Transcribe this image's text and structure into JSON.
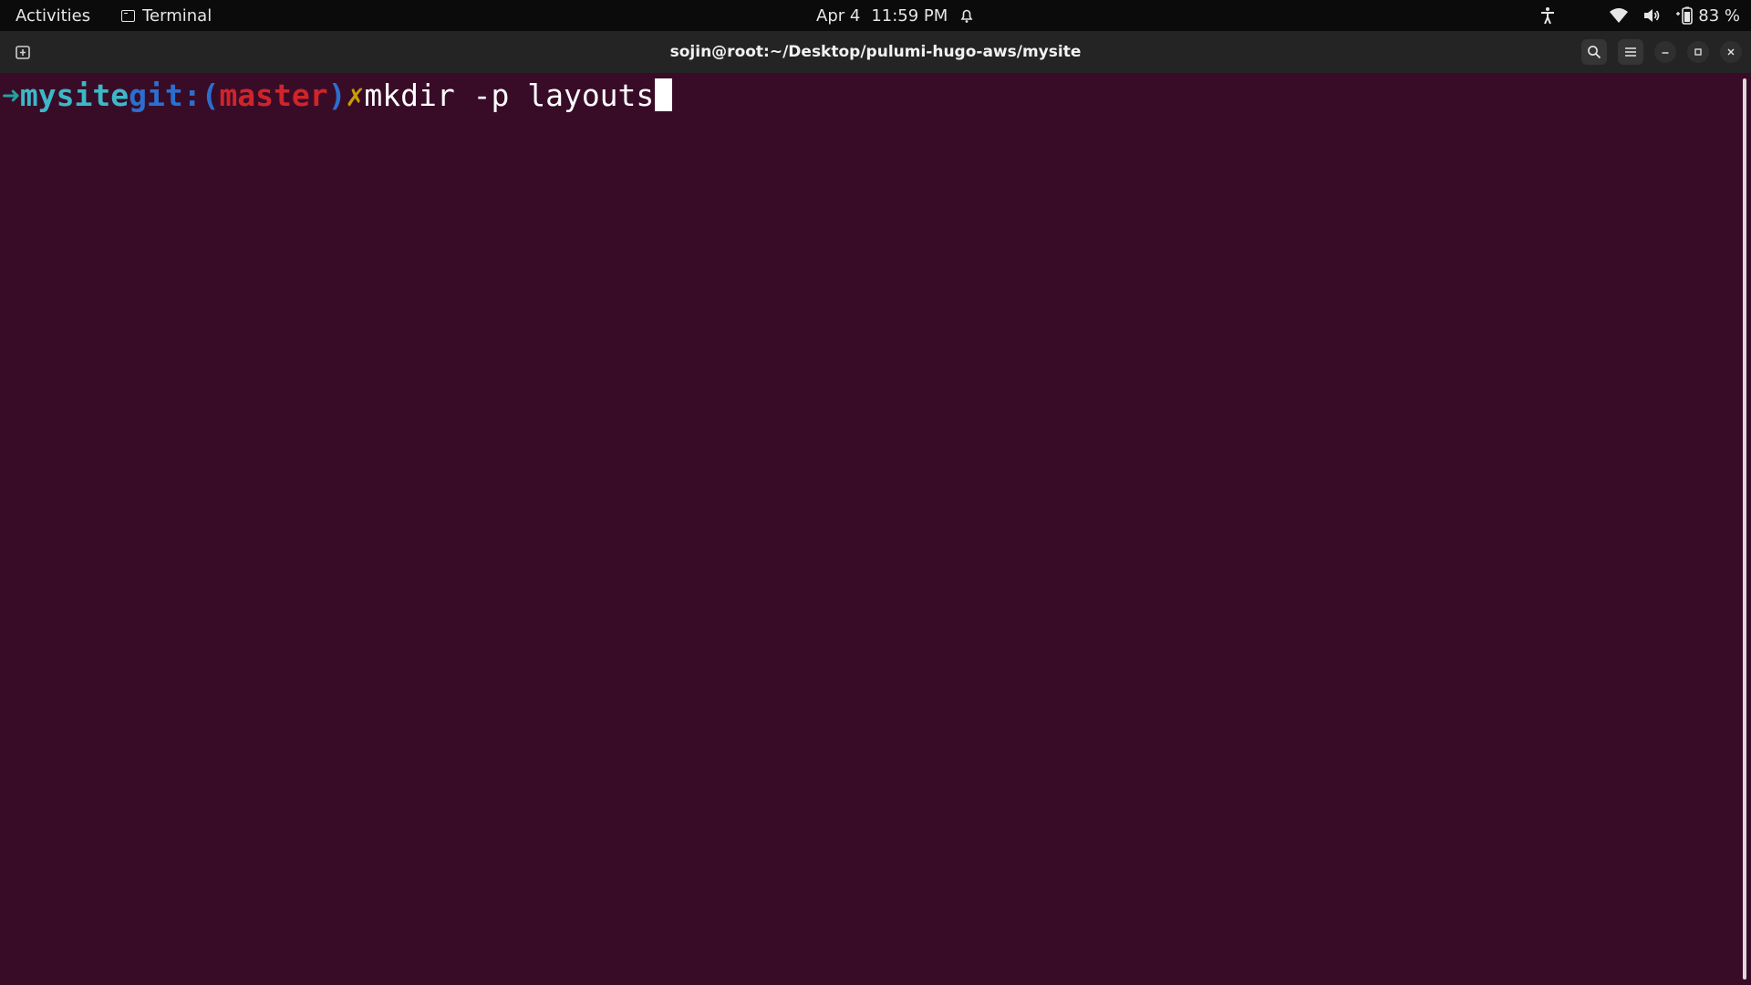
{
  "topbar": {
    "activities_label": "Activities",
    "app_label": "Terminal",
    "date": "Apr 4",
    "time": "11:59 PM",
    "battery_percent": "83 %",
    "icons": [
      "terminal-icon",
      "alarm-icon",
      "accessibility-icon",
      "wifi-icon",
      "volume-icon",
      "battery-icon"
    ]
  },
  "window": {
    "title": "sojin@root:~/Desktop/pulumi-hugo-aws/mysite",
    "buttons": [
      "new-tab",
      "search",
      "menu",
      "minimize",
      "maximize",
      "close"
    ]
  },
  "terminal": {
    "prompt_arrow": "➜",
    "directory": "mysite",
    "git_prefix": "git:(",
    "branch": "master",
    "git_suffix": ")",
    "dirty_marker": "✗",
    "command": "mkdir -p layouts"
  },
  "colors": {
    "terminal_bg": "#380c27",
    "prompt_arrow": "#26a0a0",
    "directory": "#3cb8c8",
    "git": "#2b6fcf",
    "branch": "#d0242b",
    "dirty": "#c4a000"
  }
}
